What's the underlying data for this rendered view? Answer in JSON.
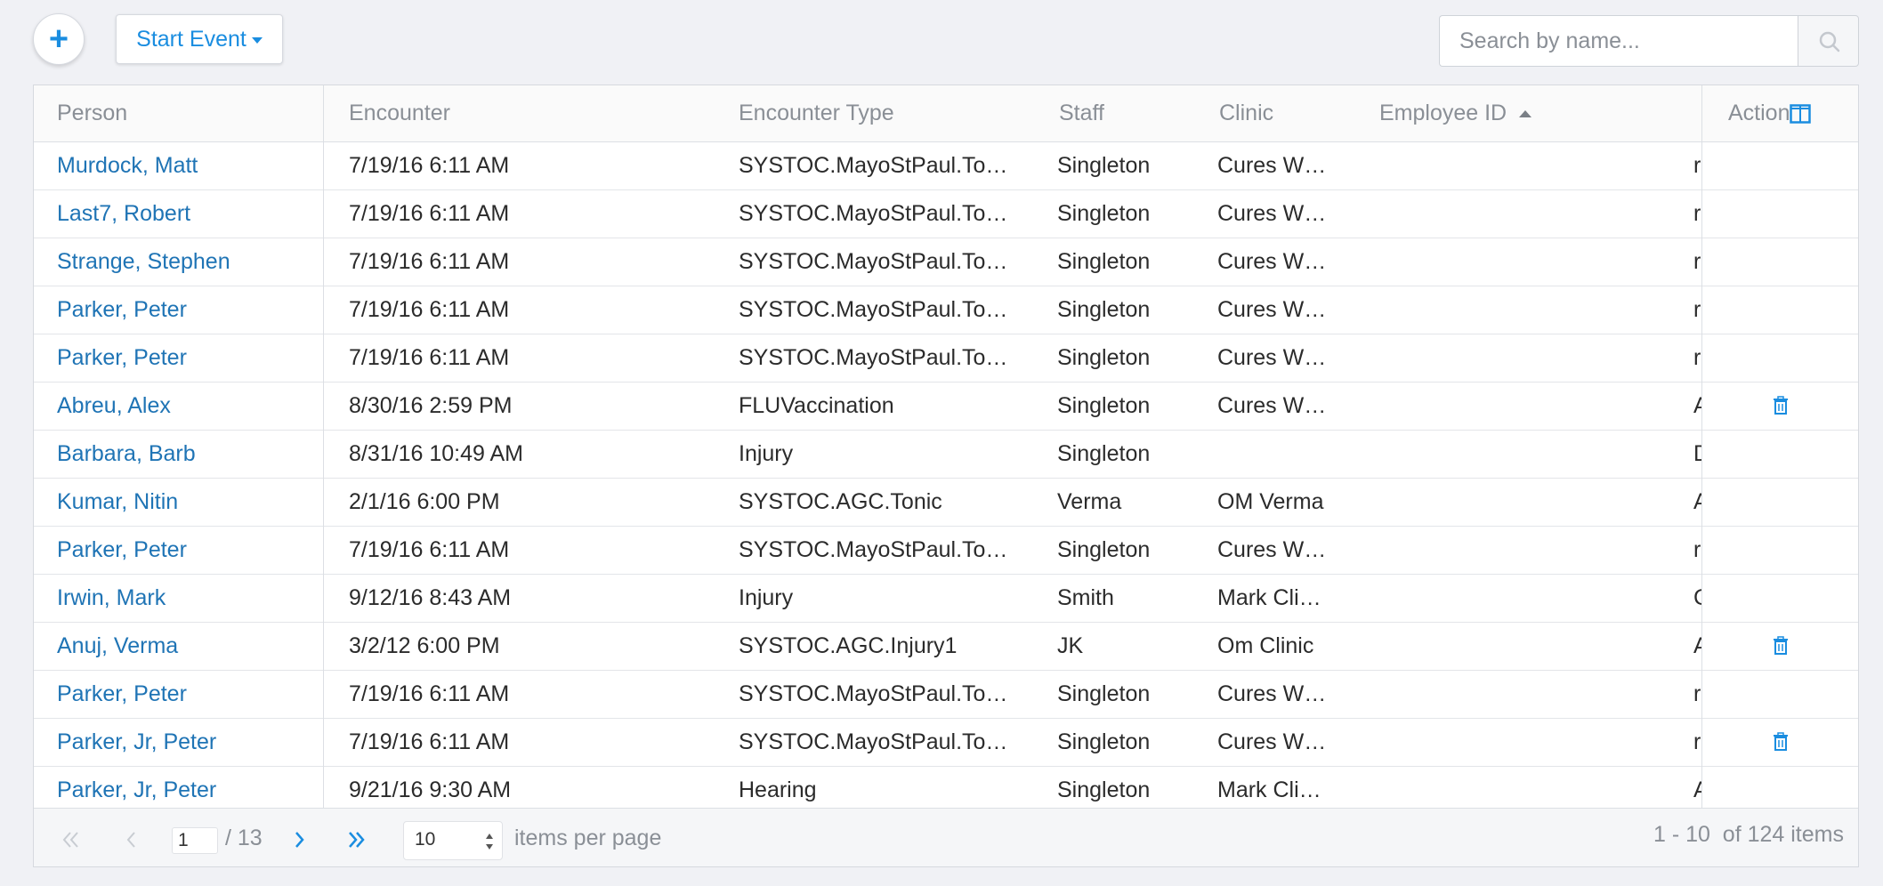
{
  "toolbar": {
    "add_label": "+",
    "start_event_label": "Start Event",
    "search_placeholder": "Search by name..."
  },
  "columns": {
    "person": "Person",
    "encounter": "Encounter",
    "encounter_type": "Encounter Type",
    "staff": "Staff",
    "clinic": "Clinic",
    "employee_id": "Employee ID",
    "action": "Action"
  },
  "rows": [
    {
      "person": "Murdock, Matt",
      "encounter": "7/19/16 6:11 AM",
      "type": "SYSTOC.MayoStPaul.To…",
      "staff": "Singleton",
      "clinic": "Cures W…",
      "overflow": "r",
      "has_delete": false
    },
    {
      "person": "Last7, Robert",
      "encounter": "7/19/16 6:11 AM",
      "type": "SYSTOC.MayoStPaul.To…",
      "staff": "Singleton",
      "clinic": "Cures W…",
      "overflow": "r",
      "has_delete": false
    },
    {
      "person": "Strange, Stephen",
      "encounter": "7/19/16 6:11 AM",
      "type": "SYSTOC.MayoStPaul.To…",
      "staff": "Singleton",
      "clinic": "Cures W…",
      "overflow": "r",
      "has_delete": false
    },
    {
      "person": "Parker, Peter",
      "encounter": "7/19/16 6:11 AM",
      "type": "SYSTOC.MayoStPaul.To…",
      "staff": "Singleton",
      "clinic": "Cures W…",
      "overflow": "r",
      "has_delete": false
    },
    {
      "person": "Parker, Peter",
      "encounter": "7/19/16 6:11 AM",
      "type": "SYSTOC.MayoStPaul.To…",
      "staff": "Singleton",
      "clinic": "Cures W…",
      "overflow": "r",
      "has_delete": false
    },
    {
      "person": "Abreu, Alex",
      "encounter": "8/30/16 2:59 PM",
      "type": "FLUVaccination",
      "staff": "Singleton",
      "clinic": "Cures W…",
      "overflow": "A",
      "has_delete": true
    },
    {
      "person": "Barbara, Barb",
      "encounter": "8/31/16 10:49 AM",
      "type": "Injury",
      "staff": "Singleton",
      "clinic": "",
      "overflow": "D",
      "has_delete": false
    },
    {
      "person": "Kumar, Nitin",
      "encounter": "2/1/16 6:00 PM",
      "type": "SYSTOC.AGC.Tonic",
      "staff": "Verma",
      "clinic": "OM Verma",
      "overflow": "A",
      "has_delete": false
    },
    {
      "person": "Parker, Peter",
      "encounter": "7/19/16 6:11 AM",
      "type": "SYSTOC.MayoStPaul.To…",
      "staff": "Singleton",
      "clinic": "Cures W…",
      "overflow": "r",
      "has_delete": false
    },
    {
      "person": "Irwin, Mark",
      "encounter": "9/12/16 8:43 AM",
      "type": "Injury",
      "staff": "Smith",
      "clinic": "Mark Cli…",
      "overflow": "C",
      "has_delete": false
    },
    {
      "person": "Anuj, Verma",
      "encounter": "3/2/12 6:00 PM",
      "type": "SYSTOC.AGC.Injury1",
      "staff": "JK",
      "clinic": "Om Clinic",
      "overflow": "A",
      "has_delete": true
    },
    {
      "person": "Parker, Peter",
      "encounter": "7/19/16 6:11 AM",
      "type": "SYSTOC.MayoStPaul.To…",
      "staff": "Singleton",
      "clinic": "Cures W…",
      "overflow": "r",
      "has_delete": false
    },
    {
      "person": "Parker, Jr, Peter",
      "encounter": "7/19/16 6:11 AM",
      "type": "SYSTOC.MayoStPaul.To…",
      "staff": "Singleton",
      "clinic": "Cures W…",
      "overflow": "r",
      "has_delete": true
    },
    {
      "person": "Parker, Jr, Peter",
      "encounter": "9/21/16 9:30 AM",
      "type": "Hearing",
      "staff": "Singleton",
      "clinic": "Mark Cli…",
      "overflow": "A",
      "has_delete": false
    }
  ],
  "pager": {
    "current_page": "1",
    "total_pages_label": "/ 13",
    "page_size": "10",
    "items_per_page_label": "items per page",
    "range_label": "1 - 10  of 124 items"
  },
  "colors": {
    "accent": "#1a8de0",
    "link": "#1f74b5",
    "muted": "#8a8f96"
  }
}
